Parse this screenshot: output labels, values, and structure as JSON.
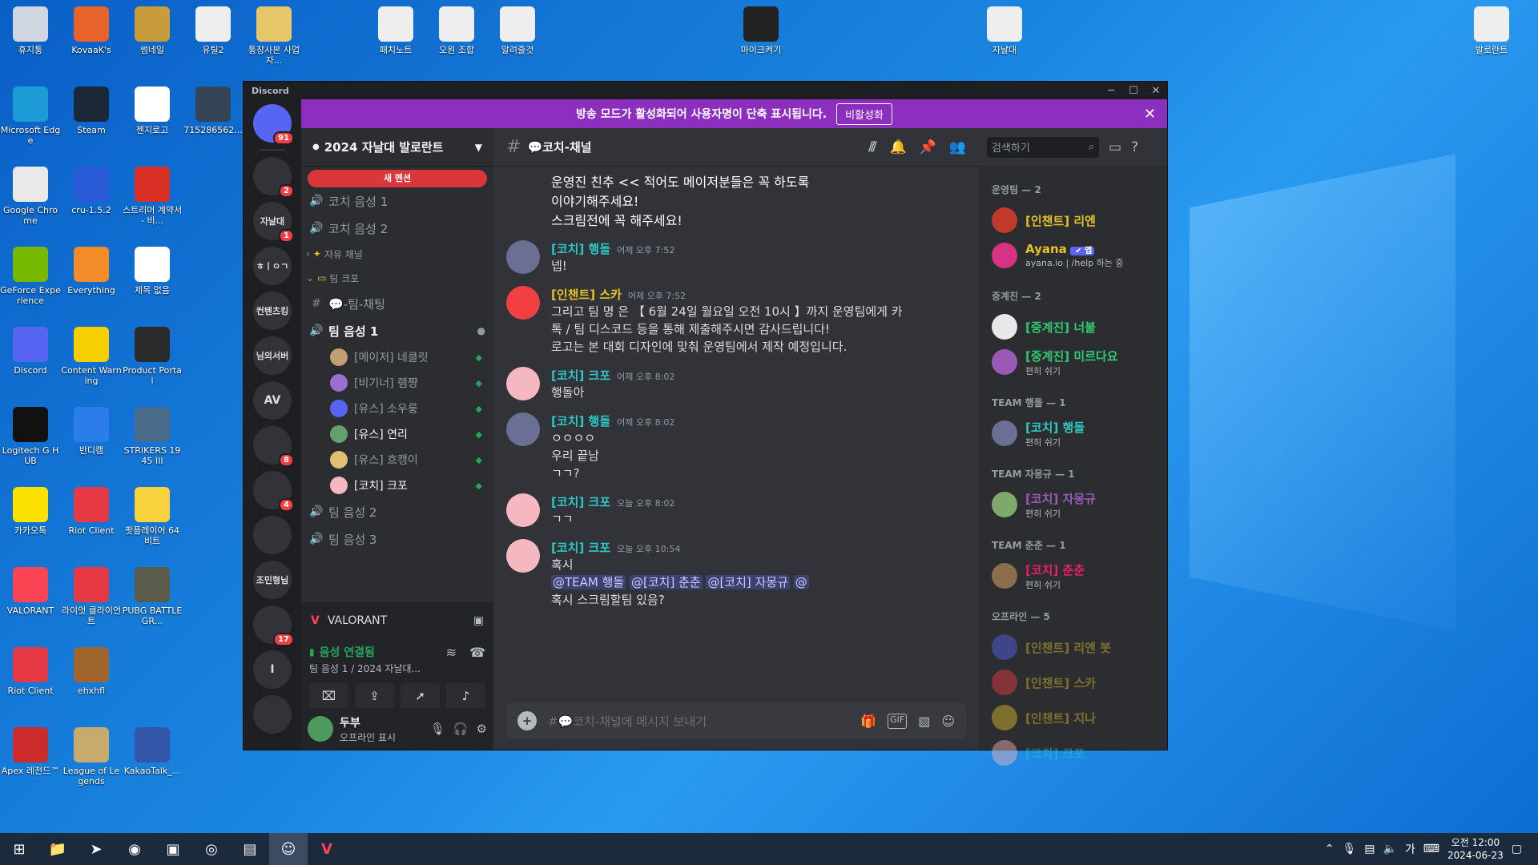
{
  "desktop": {
    "icons": [
      {
        "label": "휴지통",
        "color": "#d0d6df"
      },
      {
        "label": "KovaaK's",
        "color": "#e8632b"
      },
      {
        "label": "썸네일",
        "color": "#c89b3c"
      },
      {
        "label": "유틸2",
        "color": "#eeeeee"
      },
      {
        "label": "통장사본 사업자...",
        "color": "#e7c66a"
      },
      {
        "label": "패치노트",
        "color": "#eeeeee"
      },
      {
        "label": "오원 조합",
        "color": "#eeeeee"
      },
      {
        "label": "알려줄것",
        "color": "#eeeeee"
      },
      {
        "label": "마이크켜기",
        "color": "#222222"
      },
      {
        "label": "자날대",
        "color": "#eeeeee"
      },
      {
        "label": "발로란트",
        "color": "#eeeeee"
      },
      {
        "label": "Microsoft Edge",
        "color": "#1d9bd6"
      },
      {
        "label": "Steam",
        "color": "#1b2838"
      },
      {
        "label": "젠지로고",
        "color": "#ffffff"
      },
      {
        "label": "715286562...",
        "color": "#334455"
      },
      {
        "label": "Google Chrome",
        "color": "#e9e9e9"
      },
      {
        "label": "cru-1.5.2",
        "color": "#2a5bd7"
      },
      {
        "label": "스트리머 계약서 - 비...",
        "color": "#d93025"
      },
      {
        "label": "GeForce Experience",
        "color": "#76b900"
      },
      {
        "label": "Everything",
        "color": "#f28c28"
      },
      {
        "label": "제목 없음",
        "color": "#ffffff"
      },
      {
        "label": "Discord",
        "color": "#5865f2"
      },
      {
        "label": "Content Warning",
        "color": "#f5d000"
      },
      {
        "label": "Product Portal",
        "color": "#2b2b2b"
      },
      {
        "label": "Logitech G HUB",
        "color": "#111111"
      },
      {
        "label": "반디캠",
        "color": "#2b7de9"
      },
      {
        "label": "STRIKERS 1945 III",
        "color": "#4a6b8a"
      },
      {
        "label": "카카오톡",
        "color": "#fae100"
      },
      {
        "label": "Riot Client",
        "color": "#e63946"
      },
      {
        "label": "팟플레이어 64 비트",
        "color": "#f7d23e"
      },
      {
        "label": "VALORANT",
        "color": "#fa4454"
      },
      {
        "label": "라이엇 클라이언트",
        "color": "#e63946"
      },
      {
        "label": "PUBG BATTLEGR...",
        "color": "#5b5b4b"
      },
      {
        "label": "Riot Client",
        "color": "#e63946"
      },
      {
        "label": "ehxhfl",
        "color": "#a0652d"
      },
      {
        "label": "Apex 레전드™",
        "color": "#cc2b2b"
      },
      {
        "label": "League of Legends",
        "color": "#c8aa6e"
      },
      {
        "label": "KakaoTalk_...",
        "color": "#3355aa"
      }
    ]
  },
  "window": {
    "title": "Discord",
    "banner_text": "방송 모드가 활성화되어 사용자명이 단축 표시됩니다.",
    "banner_button": "비활성화"
  },
  "servers": {
    "items": [
      {
        "label": "",
        "badge": "91"
      },
      {
        "label": "",
        "badge": "2"
      },
      {
        "label": "자날대",
        "badge": "1"
      },
      {
        "label": "ㅎㅣㅇㄱ",
        "badge": ""
      },
      {
        "label": "컨텐츠킹",
        "badge": ""
      },
      {
        "label": "님의서버",
        "badge": ""
      },
      {
        "label": "AV",
        "badge": ""
      },
      {
        "label": "",
        "badge": "8"
      },
      {
        "label": "",
        "badge": "4"
      },
      {
        "label": "",
        "badge": ""
      },
      {
        "label": "조민형님",
        "badge": ""
      },
      {
        "label": "",
        "badge": "17"
      },
      {
        "label": "I",
        "badge": ""
      },
      {
        "label": "",
        "badge": ""
      }
    ]
  },
  "sidebar": {
    "guild_name": "2024 자날대 발로란트",
    "new_mentions": "새 멘션",
    "channels_top": [
      {
        "name": "코치 음성 1",
        "icon": "speaker-icon"
      },
      {
        "name": "코치 음성 2",
        "icon": "speaker-icon"
      }
    ],
    "category_free": "자유 채널",
    "category_team": "팀 크포",
    "team_text_channel": "💬-팀-채팅",
    "team_voice_channel": "팀 음성 1",
    "voice_users": [
      {
        "name": "[메이저] 네클릿",
        "bright": false,
        "color": "#c0a070"
      },
      {
        "name": "[비기너] 렘쨩",
        "bright": false,
        "color": "#9a6fd0"
      },
      {
        "name": "[유스] 소우룽",
        "bright": false,
        "color": "#5865f2"
      },
      {
        "name": "[유스] 연리",
        "bright": true,
        "color": "#62a06d"
      },
      {
        "name": "[유스] 흐캥이",
        "bright": false,
        "color": "#e0c070"
      },
      {
        "name": "[코치] 크포",
        "bright": true,
        "color": "#f5b7c0"
      }
    ],
    "voice_channels_bottom": [
      {
        "name": "팀 음성 2"
      },
      {
        "name": "팀 음성 3"
      }
    ],
    "activity": "VALORANT",
    "voice_connected": "음성 연결됨",
    "voice_channel_sub": "팀 음성 1 / 2024 자날대...",
    "user_name": "두부",
    "user_status": "오프라인 표시"
  },
  "chat": {
    "channel_name": "💬코치-채널",
    "search_placeholder": "검색하기",
    "input_placeholder": "#💬코치-채널에 메시지 보내기",
    "continuation_top": [
      "운영진 친추 <<  적어도 메이저분들은 꼭 하도록",
      "이야기해주세요!",
      "스크림전에 꼭 해주세요!"
    ],
    "messages": [
      {
        "author": "[코치] 행돌",
        "color": "#2dc7c4",
        "time": "어제 오후 7:52",
        "lines": [
          "넵!"
        ],
        "avatar": "#6b6f93"
      },
      {
        "author": "[인챈트] 스카",
        "color": "#e6c229",
        "time": "어제 오후 7:52",
        "lines": [
          "그리고 팀 명 은 【 6월 24일 월요일 오전 10시 】까지 운영팀에게 카",
          "톡 / 팀 디스코드 등을 통해 제출해주시면 감사드립니다!",
          " ",
          "로고는 본 대회 디자인에 맞춰 운영팀에서 제작 예정입니다."
        ],
        "avatar": "#f23f43"
      },
      {
        "author": "[코치] 크포",
        "color": "#2dc7c4",
        "time": "어제 오후 8:02",
        "lines": [
          "행돌아"
        ],
        "avatar": "#f5b7c0"
      },
      {
        "author": "[코치] 행돌",
        "color": "#2dc7c4",
        "time": "어제 오후 8:02",
        "lines": [
          "ㅇㅇㅇㅇ",
          "우리 끝남",
          "ㄱㄱ?"
        ],
        "avatar": "#6b6f93"
      },
      {
        "author": "[코치] 크포",
        "color": "#2dc7c4",
        "time": "오늘 오후 8:02",
        "lines": [
          "ㄱㄱ"
        ],
        "avatar": "#f5b7c0"
      },
      {
        "author": "[코치] 크포",
        "color": "#2dc7c4",
        "time": "오늘 오후 10:54",
        "lines": [
          "혹시"
        ],
        "avatar": "#f5b7c0"
      }
    ],
    "mentions": [
      "@TEAM 행돌",
      "@[코치] 춘춘",
      "@[코치] 자몽규",
      "@"
    ],
    "last_line": "혹시 스크림할팀 있음?"
  },
  "members": {
    "groups": [
      {
        "title": "운영팀 — 2",
        "members": [
          {
            "name": "[인챈트] 리엔",
            "status": "",
            "color": "#e6c229",
            "avatar": "#c0392b",
            "off": false
          },
          {
            "name": "Ayana",
            "status": "ayana.io | /help 하는 중",
            "color": "#e6c229",
            "avatar": "#d63384",
            "off": false,
            "tag": "✔ 앱"
          }
        ]
      },
      {
        "title": "중계진 — 2",
        "members": [
          {
            "name": "[중계진] 너불",
            "status": "",
            "color": "#2ecc71",
            "avatar": "#e8e8e8",
            "off": false
          },
          {
            "name": "[중계진] 미르다요",
            "status": "편히 쉬기",
            "color": "#2ecc71",
            "avatar": "#9b59b6",
            "off": false
          }
        ]
      },
      {
        "title": "TEAM 행돌 — 1",
        "members": [
          {
            "name": "[코치] 행돌",
            "status": "편히 쉬기",
            "color": "#2dc7c4",
            "avatar": "#6b6f93",
            "off": false
          }
        ]
      },
      {
        "title": "TEAM 자몽규 — 1",
        "members": [
          {
            "name": "[코치] 자몽규",
            "status": "편히 쉬기",
            "color": "#9b59b6",
            "avatar": "#7fa86b",
            "off": false
          }
        ]
      },
      {
        "title": "TEAM 춘춘 — 1",
        "members": [
          {
            "name": "[코치] 춘춘",
            "status": "편히 쉬기",
            "color": "#e91e63",
            "avatar": "#8d6e4a",
            "off": false
          }
        ]
      },
      {
        "title": "오프라인 — 5",
        "members": [
          {
            "name": "[인챈트] 리엔 봇",
            "status": "",
            "color": "#e6c229",
            "avatar": "#5865f2",
            "off": true
          },
          {
            "name": "[인챈트] 스카",
            "status": "",
            "color": "#e6c229",
            "avatar": "#f23f43",
            "off": true
          },
          {
            "name": "[인챈트] 지나",
            "status": "",
            "color": "#e6c229",
            "avatar": "#e6c229",
            "off": true
          },
          {
            "name": "[코치] 크포",
            "status": "",
            "color": "#2dc7c4",
            "avatar": "#f5b7c0",
            "off": true
          }
        ]
      }
    ]
  },
  "taskbar": {
    "apps": [
      "windows-icon",
      "file-explorer-icon",
      "bandicam-icon",
      "chrome-icon",
      "live-icon",
      "obs-icon",
      "notepad-icon",
      "discord-icon",
      "valorant-icon"
    ],
    "tray_lang": "가",
    "time": "오전 12:00",
    "date": "2024-06-23"
  }
}
